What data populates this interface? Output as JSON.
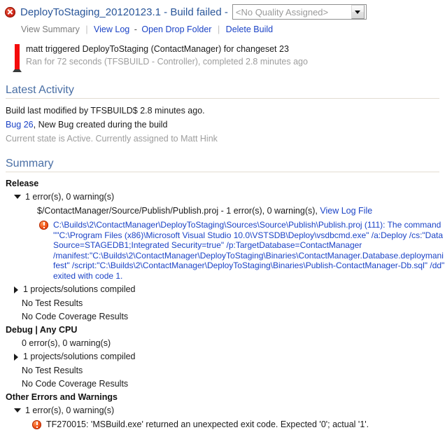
{
  "header": {
    "status_icon": "error-circle-icon",
    "title": "DeployToStaging_20120123.1 - Build failed -",
    "quality": {
      "selected": "<No Quality Assigned>",
      "arrow_icon": "chevron-down-icon"
    }
  },
  "actions": {
    "view_summary": "View Summary",
    "view_log": "View Log",
    "open_drop_folder": "Open Drop Folder",
    "delete_build": "Delete Build",
    "separator_bar": "|",
    "separator_dash": "-"
  },
  "trigger": {
    "indicator_icon": "red-status-bar-icon",
    "line1": "matt triggered DeployToStaging (ContactManager) for changeset 23",
    "line2": "Ran for 72 seconds (TFSBUILD - Controller), completed 2.8 minutes ago"
  },
  "latest_activity": {
    "heading": "Latest Activity",
    "modified_line": "Build last modified by TFSBUILD$ 2.8 minutes ago.",
    "bug_link": "Bug 26",
    "bug_rest": ", New Bug created during the build",
    "bug_state": "Current state is Active. Currently assigned to Matt Hink"
  },
  "summary": {
    "heading": "Summary",
    "configurations": [
      {
        "name": "Release",
        "toggle_icon": "triangle-down-icon",
        "counts": "1 error(s), 0 warning(s)",
        "project_line": "$/ContactManager/Source/Publish/Publish.proj - 1 error(s), 0 warning(s),",
        "project_log_link": "View Log File",
        "error_icon": "error-exclamation-icon",
        "error_message": "C:\\Builds\\2\\ContactManager\\DeployToStaging\\Sources\\Source\\Publish\\Publish.proj (111): The command \"\"C:\\Program Files (x86)\\Microsoft Visual Studio 10.0\\VSTSDB\\Deploy\\vsdbcmd.exe\" /a:Deploy /cs:\"Data Source=STAGEDB1;Integrated Security=true\" /p:TargetDatabase=ContactManager /manifest:\"C:\\Builds\\2\\ContactManager\\DeployToStaging\\Binaries\\ContactManager.Database.deploymanifest\" /script:\"C:\\Builds\\2\\ContactManager\\DeployToStaging\\Binaries\\Publish-ContactManager-Db.sql\" /dd\" exited with code 1.",
        "compiled": "1 projects/solutions compiled",
        "compiled_toggle_icon": "triangle-right-icon",
        "test_results": "No Test Results",
        "coverage_results": "No Code Coverage Results"
      },
      {
        "name": "Debug | Any CPU",
        "counts": "0 error(s), 0 warning(s)",
        "compiled": "1 projects/solutions compiled",
        "compiled_toggle_icon": "triangle-right-icon",
        "test_results": "No Test Results",
        "coverage_results": "No Code Coverage Results"
      }
    ],
    "other_errors": {
      "name": "Other Errors and Warnings",
      "toggle_icon": "triangle-down-icon",
      "counts": "1 error(s), 0 warning(s)",
      "error_icon": "error-exclamation-icon",
      "error_message": "TF270015: 'MSBuild.exe' returned an unexpected exit code. Expected '0'; actual '1'."
    }
  },
  "colors": {
    "title_blue": "#2a5699",
    "link_blue": "#1b43c6",
    "heading_blue": "#4a6fa5",
    "error_red": "#d2281b",
    "error_orange": "#f2551a",
    "muted_gray": "#9d9d9d"
  }
}
